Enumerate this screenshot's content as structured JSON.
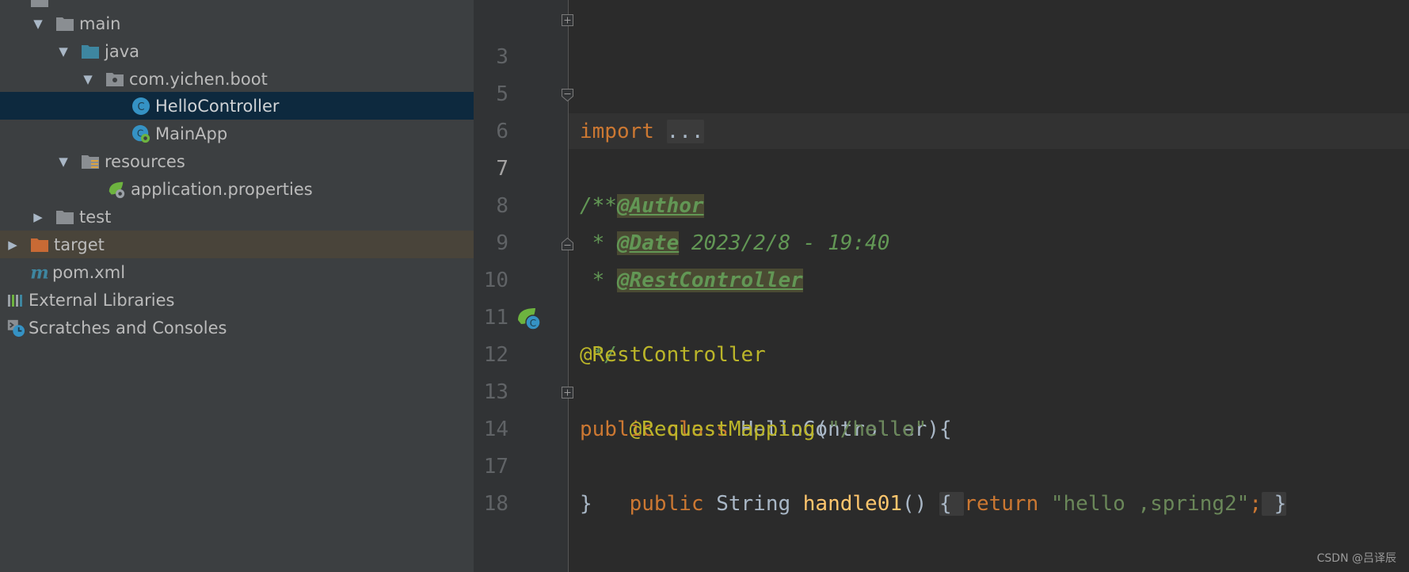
{
  "project_tree": {
    "items": [
      {
        "label": "main",
        "expanded": true,
        "kind": "folder"
      },
      {
        "label": "java",
        "expanded": true,
        "kind": "source-folder"
      },
      {
        "label": "com.yichen.boot",
        "expanded": true,
        "kind": "package"
      },
      {
        "label": "HelloController",
        "kind": "class",
        "selected": true
      },
      {
        "label": "MainApp",
        "kind": "spring-boot-class"
      },
      {
        "label": "resources",
        "expanded": true,
        "kind": "resources-folder"
      },
      {
        "label": "application.properties",
        "kind": "spring-properties"
      },
      {
        "label": "test",
        "expanded": false,
        "kind": "folder"
      },
      {
        "label": "target",
        "expanded": false,
        "kind": "excluded-folder"
      },
      {
        "label": "pom.xml",
        "kind": "maven-file"
      },
      {
        "label": "External Libraries",
        "kind": "libraries"
      },
      {
        "label": "Scratches and Consoles",
        "kind": "scratches"
      }
    ]
  },
  "editor": {
    "current_line": "7",
    "lines": [
      {
        "num": "3",
        "tokens": {
          "t1": "import",
          "t2": " ",
          "t3": "..."
        }
      },
      {
        "num": "5"
      },
      {
        "num": "6",
        "tokens": {
          "t1": "/**"
        }
      },
      {
        "num": "7",
        "tokens": {
          "t1": " * ",
          "t2": "@Author"
        }
      },
      {
        "num": "8",
        "tokens": {
          "t1": " * ",
          "t2": "@Date",
          "t3": " 2023/2/8 - 19:40"
        }
      },
      {
        "num": "9",
        "tokens": {
          "t1": " * ",
          "t2": "@RestController"
        }
      },
      {
        "num": "10",
        "tokens": {
          "t1": " */"
        }
      },
      {
        "num": "11",
        "tokens": {
          "t1": "@RestController"
        }
      },
      {
        "num": "12",
        "tokens": {
          "t1": "public",
          "t2": " ",
          "t3": "class",
          "t4": " HelloController {"
        }
      },
      {
        "num": "13",
        "tokens": {
          "t1": "    ",
          "t2": "@RequestMapping",
          "t3": "(",
          "t4": "\"/hello\"",
          "t5": ")"
        }
      },
      {
        "num": "14",
        "tokens": {
          "t1": "    ",
          "t2": "public",
          "t3": " String ",
          "t4": "handle01",
          "t5": "()",
          "t6": " ",
          "t7": "{ ",
          "t8": "return",
          "t9": " ",
          "t10": "\"hello ,spring2\"",
          "t11": ";",
          "t12": " }"
        }
      },
      {
        "num": "17",
        "tokens": {
          "t1": "}"
        }
      },
      {
        "num": "18"
      }
    ]
  },
  "watermark": "CSDN @吕译辰",
  "colors": {
    "keyword": "#cc7832",
    "annotation": "#bbb529",
    "string": "#6a8759",
    "method": "#ffc66d",
    "doc_comment": "#629755",
    "selection": "#0d293e"
  }
}
